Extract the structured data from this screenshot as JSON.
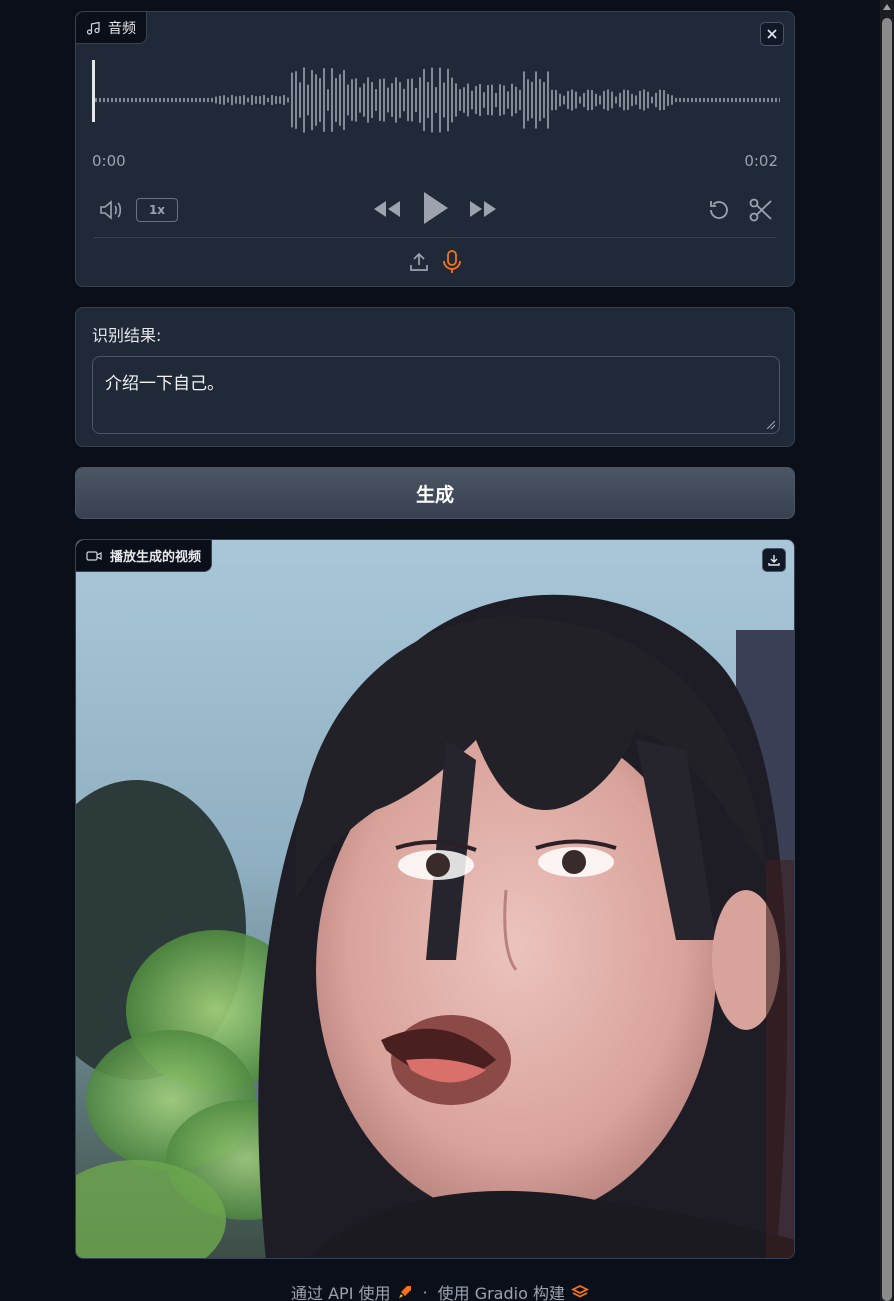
{
  "audio": {
    "label": "音频",
    "time_start": "0:00",
    "time_end": "0:02",
    "speed": "1x"
  },
  "result": {
    "label": "识别结果:",
    "value": "介绍一下自己。"
  },
  "generate_button": "生成",
  "video": {
    "label": "播放生成的视频"
  },
  "footer": {
    "api_link": "通过 API 使用",
    "separator": "·",
    "built_with": "使用 Gradio 构建"
  },
  "colors": {
    "background": "#0b0f19",
    "panel": "#1f2937",
    "accent_mic": "#f97316"
  },
  "icons": [
    "music-icon",
    "close-icon",
    "volume-icon",
    "rewind-icon",
    "play-icon",
    "fast-forward-icon",
    "undo-icon",
    "scissors-icon",
    "upload-icon",
    "microphone-icon",
    "video-icon",
    "download-icon",
    "rocket-icon",
    "gradio-logo-icon"
  ]
}
